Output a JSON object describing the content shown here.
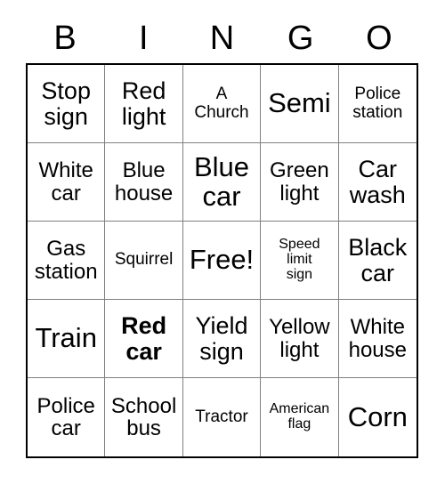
{
  "header": {
    "letters": [
      "B",
      "I",
      "N",
      "G",
      "O"
    ]
  },
  "grid": {
    "rows": 5,
    "columns": 5,
    "border_color": "#000000",
    "inner_line_color": "#808080",
    "background": "#ffffff",
    "text_color": "#000000"
  },
  "cells": [
    {
      "text": "Stop\nsign",
      "size": "lg",
      "bold": false
    },
    {
      "text": "Red\nlight",
      "size": "lg",
      "bold": false
    },
    {
      "text": "A\nChurch",
      "size": "sm",
      "bold": false
    },
    {
      "text": "Semi",
      "size": "xl",
      "bold": false
    },
    {
      "text": "Police\nstation",
      "size": "sm",
      "bold": false
    },
    {
      "text": "White\ncar",
      "size": "md",
      "bold": false
    },
    {
      "text": "Blue\nhouse",
      "size": "md",
      "bold": false
    },
    {
      "text": "Blue\ncar",
      "size": "xl",
      "bold": false
    },
    {
      "text": "Green\nlight",
      "size": "md",
      "bold": false
    },
    {
      "text": "Car\nwash",
      "size": "lg",
      "bold": false
    },
    {
      "text": "Gas\nstation",
      "size": "md",
      "bold": false
    },
    {
      "text": "Squirrel",
      "size": "sm",
      "bold": false
    },
    {
      "text": "Free!",
      "size": "xl",
      "bold": false
    },
    {
      "text": "Speed\nlimit\nsign",
      "size": "xs",
      "bold": false
    },
    {
      "text": "Black\ncar",
      "size": "lg",
      "bold": false
    },
    {
      "text": "Train",
      "size": "xl",
      "bold": false
    },
    {
      "text": "Red\ncar",
      "size": "lg",
      "bold": true
    },
    {
      "text": "Yield\nsign",
      "size": "lg",
      "bold": false
    },
    {
      "text": "Yellow\nlight",
      "size": "md",
      "bold": false
    },
    {
      "text": "White\nhouse",
      "size": "md",
      "bold": false
    },
    {
      "text": "Police\ncar",
      "size": "md",
      "bold": false
    },
    {
      "text": "School\nbus",
      "size": "md",
      "bold": false
    },
    {
      "text": "Tractor",
      "size": "sm",
      "bold": false
    },
    {
      "text": "American\nflag",
      "size": "xs",
      "bold": false
    },
    {
      "text": "Corn",
      "size": "xl",
      "bold": false
    }
  ]
}
